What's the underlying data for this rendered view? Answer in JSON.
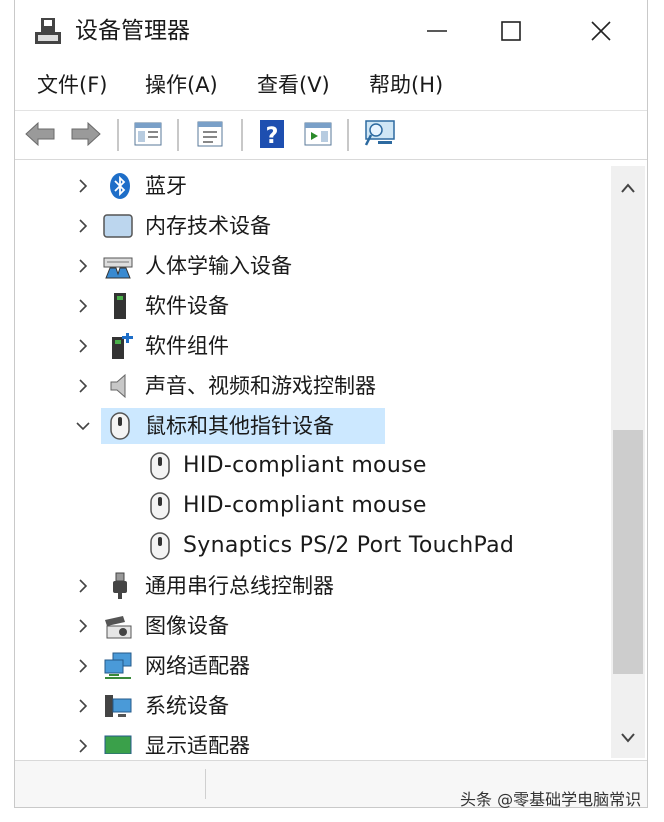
{
  "window": {
    "title": "设备管理器"
  },
  "menu": [
    {
      "id": "file",
      "label": "文件(F)"
    },
    {
      "id": "action",
      "label": "操作(A)"
    },
    {
      "id": "view",
      "label": "查看(V)"
    },
    {
      "id": "help",
      "label": "帮助(H)"
    }
  ],
  "toolbar": [
    "back-icon",
    "forward-icon",
    "show-hide-tree-icon",
    "properties-icon",
    "help-icon",
    "view-resources-icon",
    "scan-hardware-icon"
  ],
  "tree": [
    {
      "label": "蓝牙",
      "icon": "bluetooth-icon",
      "expanded": false
    },
    {
      "label": "内存技术设备",
      "icon": "memory-device-icon",
      "expanded": false
    },
    {
      "label": "人体学输入设备",
      "icon": "hid-icon",
      "expanded": false
    },
    {
      "label": "软件设备",
      "icon": "software-device-icon",
      "expanded": false
    },
    {
      "label": "软件组件",
      "icon": "software-component-icon",
      "expanded": false
    },
    {
      "label": "声音、视频和游戏控制器",
      "icon": "speaker-icon",
      "expanded": false
    },
    {
      "label": "鼠标和其他指针设备",
      "icon": "mouse-icon",
      "expanded": true,
      "selected": true
    },
    {
      "label": "HID-compliant mouse",
      "icon": "mouse-icon",
      "child": true
    },
    {
      "label": "HID-compliant mouse",
      "icon": "mouse-icon",
      "child": true
    },
    {
      "label": "Synaptics PS/2 Port TouchPad",
      "icon": "mouse-icon",
      "child": true
    },
    {
      "label": "通用串行总线控制器",
      "icon": "usb-icon",
      "expanded": false
    },
    {
      "label": "图像设备",
      "icon": "camera-icon",
      "expanded": false
    },
    {
      "label": "网络适配器",
      "icon": "network-icon",
      "expanded": false
    },
    {
      "label": "系统设备",
      "icon": "system-device-icon",
      "expanded": false
    },
    {
      "label": "显示适配器",
      "icon": "display-icon",
      "expanded": false
    }
  ],
  "watermark": "头条 @零基础学电脑常识",
  "colors": {
    "selection": "#cce8ff",
    "accent": "#1e6ec8"
  }
}
